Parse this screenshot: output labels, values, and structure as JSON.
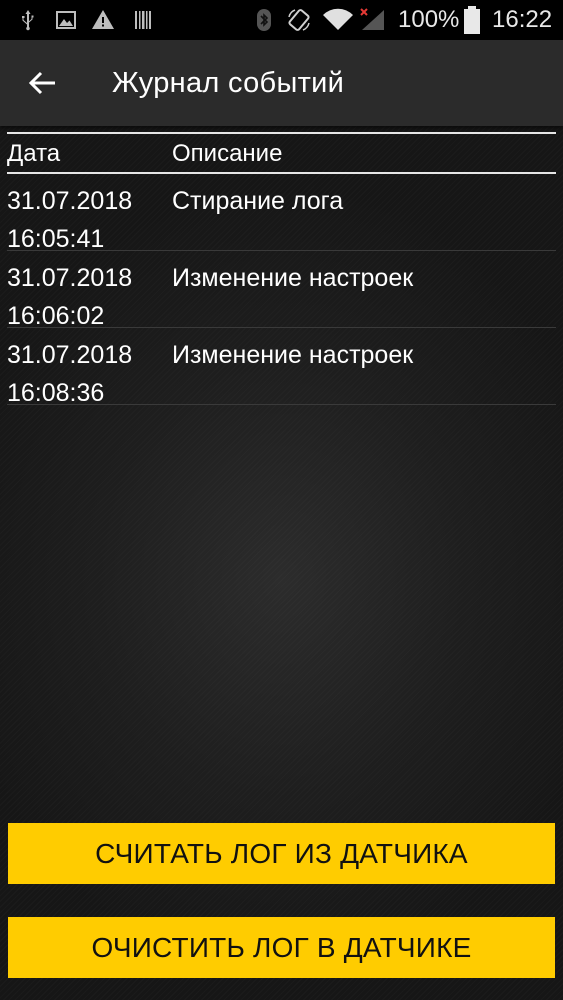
{
  "status_bar": {
    "icons": [
      "usb-icon",
      "image-icon",
      "warning-icon",
      "barcode-icon",
      "bluetooth-icon",
      "screen-rotation-icon",
      "wifi-icon",
      "signal-icon",
      "battery-icon"
    ],
    "battery_percent": "100%",
    "time": "16:22"
  },
  "app_bar": {
    "back_icon": "arrow-left-icon",
    "title": "Журнал событий"
  },
  "table": {
    "headers": {
      "date": "Дата",
      "description": "Описание"
    },
    "rows": [
      {
        "date": "31.07.2018",
        "time": "16:05:41",
        "description": "Стирание лога"
      },
      {
        "date": "31.07.2018",
        "time": "16:06:02",
        "description": "Изменение настроек"
      },
      {
        "date": "31.07.2018",
        "time": "16:08:36",
        "description": "Изменение настроек"
      }
    ]
  },
  "buttons": {
    "read_log": "СЧИТАТЬ ЛОГ ИЗ ДАТЧИКА",
    "clear_log": "ОЧИСТИТЬ ЛОГ В ДАТЧИКЕ"
  },
  "colors": {
    "accent": "#ffcc00",
    "app_bar": "#2b2b2b",
    "status_bar": "#000000",
    "background": "#1e1e1e",
    "warning_x": "#e53935"
  }
}
